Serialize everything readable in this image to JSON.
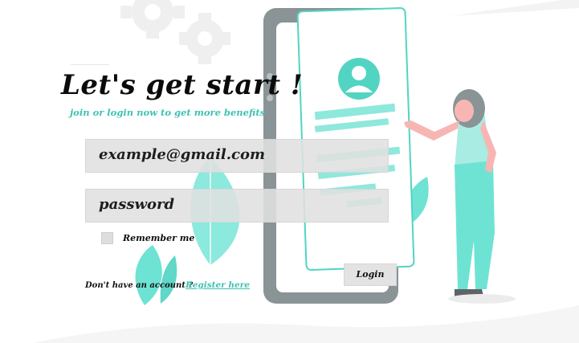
{
  "heading": {
    "title": "Let's get start !",
    "subtitle": "join or login now to get more benefits"
  },
  "form": {
    "email_value": "example@gmail.com",
    "password_value": "password",
    "remember_label": "Remember me",
    "login_label": "Login",
    "no_account_text": "Don't have an account ?",
    "register_link": "Register here"
  },
  "colors": {
    "accent": "#3fc2b2",
    "phone_body": "#8a9396",
    "field_bg": "#e0e0e0"
  },
  "icons": [
    "gear-icon",
    "user-avatar-icon",
    "leaf-plant",
    "phone-illustration",
    "woman-illustration"
  ]
}
